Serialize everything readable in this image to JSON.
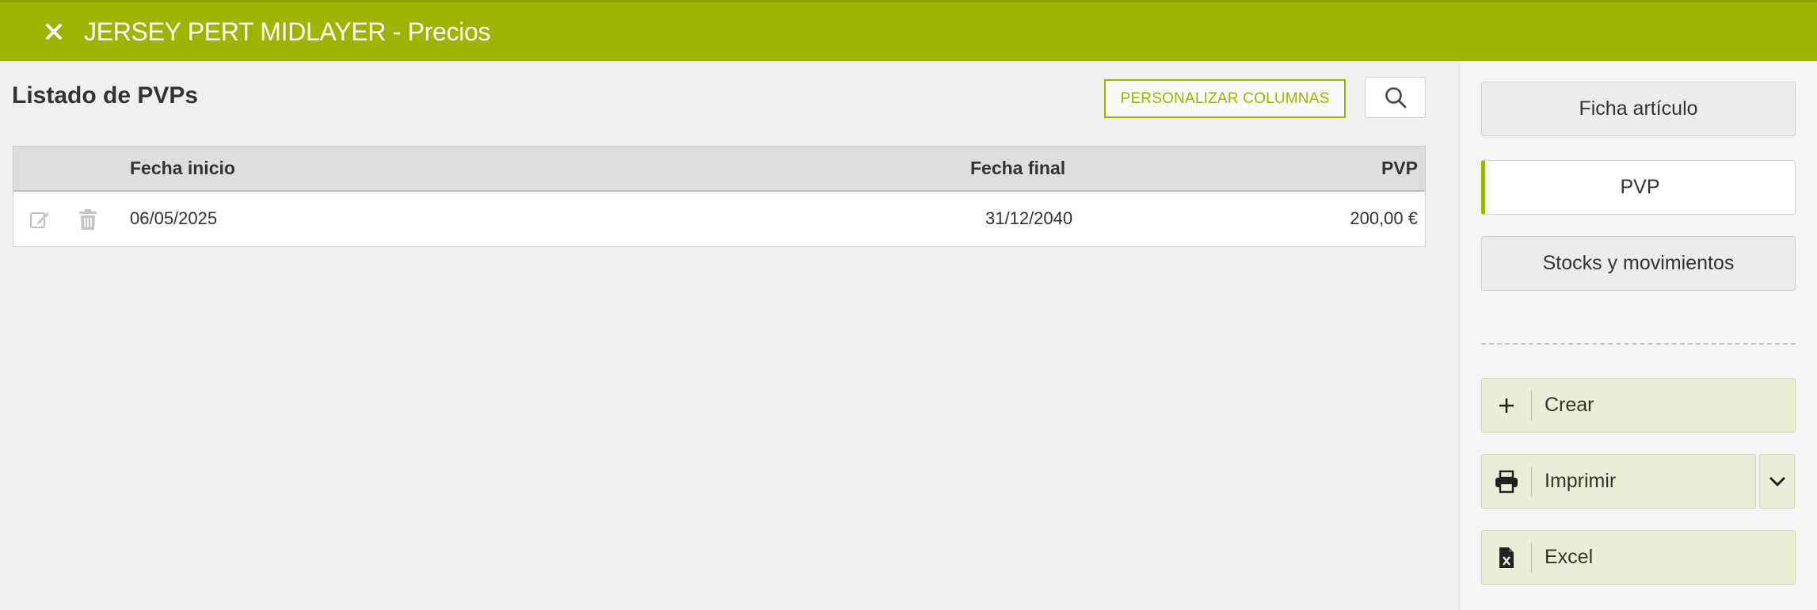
{
  "header": {
    "title": "JERSEY PERT MIDLAYER - Precios",
    "close_icon": "close-icon",
    "bg_color": "#9db400"
  },
  "list": {
    "title": "Listado de PVPs",
    "customize_columns_label": "PERSONALIZAR COLUMNAS",
    "search_icon": "search-icon"
  },
  "table": {
    "columns": [
      "Fecha inicio",
      "Fecha final",
      "PVP"
    ],
    "rows": [
      {
        "fecha_inicio": "06/05/2025",
        "fecha_final": "31/12/2040",
        "pvp": "200,00 €",
        "edit_icon": "edit-icon",
        "delete_icon": "trash-icon"
      }
    ]
  },
  "sidebar": {
    "nav": [
      {
        "label": "Ficha artículo",
        "active": false
      },
      {
        "label": "PVP",
        "active": true
      },
      {
        "label": "Stocks y movimientos",
        "active": false
      }
    ],
    "actions": [
      {
        "label": "Crear",
        "icon": "plus-icon"
      },
      {
        "label": "Imprimir",
        "icon": "printer-icon",
        "dropdown_icon": "chevron-down-icon"
      },
      {
        "label": "Excel",
        "icon": "excel-file-icon"
      }
    ]
  },
  "colors": {
    "accent": "#9db400",
    "action_bg": "#eaf0d6",
    "background": "#f0f0f0"
  }
}
